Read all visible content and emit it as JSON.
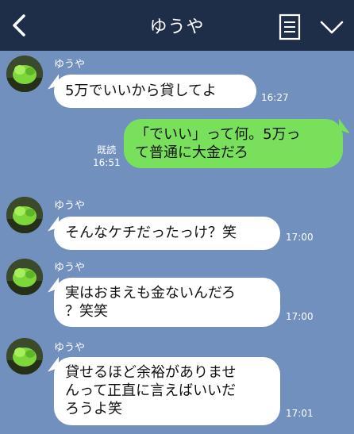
{
  "header": {
    "title": "ゆうや",
    "back_icon": "chevron-left-icon",
    "note_icon": "note-icon",
    "menu_icon": "chevron-down-icon"
  },
  "colors": {
    "header_bg": "#1f2e48",
    "chat_bg": "#7190bd",
    "incoming_bubble": "#ffffff",
    "outgoing_bubble": "#78e05a"
  },
  "messages": [
    {
      "direction": "incoming",
      "sender": "ゆうや",
      "lines": [
        "5万でいいから貸してよ"
      ],
      "time": "16:27"
    },
    {
      "direction": "outgoing",
      "read_label": "既読",
      "lines": [
        "「でいい」って何。5万っ",
        "て普通に大金だろ"
      ],
      "time": "16:51"
    },
    {
      "direction": "incoming",
      "sender": "ゆうや",
      "lines": [
        "そんなケチだったっけ？笑"
      ],
      "time": "17:00"
    },
    {
      "direction": "incoming",
      "sender": "ゆうや",
      "lines": [
        "実はおまえも金ないんだろ",
        "？笑笑"
      ],
      "time": "17:00"
    },
    {
      "direction": "incoming",
      "sender": "ゆうや",
      "lines": [
        "貸せるほど余裕がありませ",
        "んって正直に言えばいいだ",
        "ろうよ笑"
      ],
      "time": "17:01"
    }
  ]
}
